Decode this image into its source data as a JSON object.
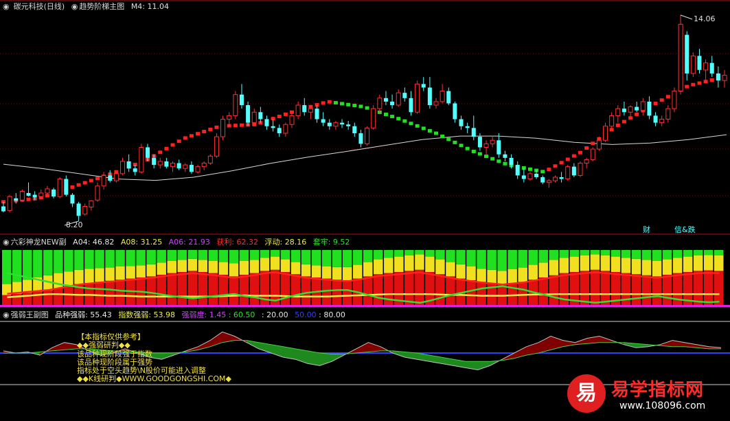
{
  "panel1": {
    "stock": "碳元科技(日线)",
    "indicator": "趋势阶梯主图",
    "m4": "M4: 11.04",
    "high_label": "14.06",
    "low_label": "8.20",
    "tag_cai": "财",
    "tag_xinfa": "信&跌"
  },
  "panel2": {
    "name": "六彩神龙NEW副",
    "a04": "A04: 46.82",
    "a08": "A08: 31.25",
    "a06": "A06: 21.93",
    "huoli": "获利: 62.32",
    "fudong": "浮动: 28.16",
    "taolao": "套牢: 9.52"
  },
  "panel3": {
    "name": "强弱王副图",
    "pinzhong": "品种强弱: 55.43",
    "zhishu": "指数强弱: 53.98",
    "qiangruodu": "强弱度: 1.45",
    "v1": ": 60.50",
    "v2": ": 20.00",
    "v3": "50.00",
    "v4": ": 80.00",
    "notes": [
      "【本指标仅供参考】",
      "◆◆强弱研判◆◆",
      "该品种现阶段强于指数",
      "该品种现阶段属于强势",
      "指标处于空头趋势\\N股价可能进入调整",
      "◆◆K线研判◆WWW.GOODGONGSHI.COM◆"
    ]
  },
  "watermark": {
    "logo": "易",
    "title": "易学指标网",
    "url": "www.108096.com"
  },
  "colors": {
    "up": "#ff3030",
    "down": "#54ffff",
    "step_up": "#ff2020",
    "step_down": "#20e020",
    "ma": "#d8d8d8"
  },
  "chart_data": [
    {
      "type": "candlestick",
      "title": "趋势阶梯主图",
      "high": 14.06,
      "low": 8.2,
      "ylim": [
        8.0,
        14.6
      ],
      "ohlc": [
        [
          8.62,
          8.75,
          8.45,
          8.48
        ],
        [
          8.5,
          8.95,
          8.45,
          8.9
        ],
        [
          8.85,
          9.0,
          8.7,
          8.78
        ],
        [
          8.8,
          9.1,
          8.75,
          9.05
        ],
        [
          9.0,
          9.3,
          8.9,
          8.92
        ],
        [
          8.95,
          9.05,
          8.8,
          8.88
        ],
        [
          8.9,
          9.1,
          8.85,
          9.0
        ],
        [
          9.0,
          9.2,
          8.95,
          9.12
        ],
        [
          9.1,
          9.15,
          8.85,
          8.9
        ],
        [
          8.9,
          9.45,
          8.85,
          9.4
        ],
        [
          9.4,
          9.5,
          8.9,
          8.95
        ],
        [
          8.95,
          9.0,
          8.6,
          8.7
        ],
        [
          8.7,
          8.75,
          8.2,
          8.35
        ],
        [
          8.4,
          8.7,
          8.35,
          8.62
        ],
        [
          8.6,
          8.8,
          8.5,
          8.78
        ],
        [
          8.8,
          9.3,
          8.75,
          9.2
        ],
        [
          9.2,
          9.6,
          9.1,
          9.5
        ],
        [
          9.5,
          9.65,
          9.3,
          9.35
        ],
        [
          9.35,
          9.6,
          9.3,
          9.55
        ],
        [
          9.55,
          10.0,
          9.5,
          9.9
        ],
        [
          9.9,
          10.1,
          9.6,
          9.7
        ],
        [
          9.7,
          9.8,
          9.5,
          9.6
        ],
        [
          9.6,
          10.4,
          9.55,
          10.3
        ],
        [
          10.3,
          10.4,
          9.9,
          10.0
        ],
        [
          10.0,
          10.1,
          9.7,
          9.8
        ],
        [
          9.8,
          10.0,
          9.7,
          9.9
        ],
        [
          9.9,
          10.0,
          9.7,
          9.75
        ],
        [
          9.75,
          9.9,
          9.6,
          9.85
        ],
        [
          9.85,
          9.95,
          9.65,
          9.7
        ],
        [
          9.7,
          9.85,
          9.6,
          9.8
        ],
        [
          9.8,
          9.9,
          9.55,
          9.6
        ],
        [
          9.6,
          9.8,
          9.55,
          9.75
        ],
        [
          9.75,
          9.9,
          9.65,
          9.85
        ],
        [
          9.85,
          10.1,
          9.8,
          10.05
        ],
        [
          10.05,
          10.7,
          10.0,
          10.6
        ],
        [
          10.6,
          11.2,
          10.5,
          11.1
        ],
        [
          11.1,
          11.3,
          10.9,
          11.2
        ],
        [
          11.2,
          11.9,
          11.1,
          11.8
        ],
        [
          11.8,
          12.1,
          11.4,
          11.5
        ],
        [
          11.5,
          11.6,
          10.9,
          11.0
        ],
        [
          11.0,
          11.4,
          10.9,
          11.3
        ],
        [
          11.3,
          11.45,
          11.0,
          11.1
        ],
        [
          11.1,
          11.2,
          10.8,
          10.9
        ],
        [
          10.9,
          11.1,
          10.75,
          10.85
        ],
        [
          10.85,
          10.95,
          10.6,
          10.7
        ],
        [
          10.7,
          11.0,
          10.6,
          10.95
        ],
        [
          10.95,
          11.3,
          10.85,
          11.2
        ],
        [
          11.2,
          11.6,
          11.1,
          11.5
        ],
        [
          11.5,
          11.7,
          11.2,
          11.3
        ],
        [
          11.3,
          11.5,
          11.1,
          11.4
        ],
        [
          11.4,
          11.5,
          11.0,
          11.1
        ],
        [
          11.1,
          11.3,
          10.9,
          11.0
        ],
        [
          11.0,
          11.1,
          10.8,
          10.9
        ],
        [
          10.9,
          11.05,
          10.8,
          11.0
        ],
        [
          11.0,
          11.1,
          10.85,
          10.95
        ],
        [
          10.95,
          11.05,
          10.8,
          10.9
        ],
        [
          10.9,
          11.0,
          10.6,
          10.7
        ],
        [
          10.7,
          10.8,
          10.3,
          10.4
        ],
        [
          10.4,
          10.9,
          10.35,
          10.85
        ],
        [
          10.85,
          11.5,
          10.8,
          11.4
        ],
        [
          11.4,
          11.8,
          11.3,
          11.7
        ],
        [
          11.7,
          11.9,
          11.5,
          11.6
        ],
        [
          11.6,
          11.8,
          11.4,
          11.5
        ],
        [
          11.5,
          11.95,
          11.45,
          11.85
        ],
        [
          11.85,
          12.0,
          11.6,
          11.7
        ],
        [
          11.7,
          11.9,
          11.2,
          11.3
        ],
        [
          11.3,
          12.2,
          11.25,
          12.1
        ],
        [
          12.1,
          12.3,
          11.9,
          12.0
        ],
        [
          12.0,
          12.3,
          11.4,
          11.5
        ],
        [
          11.5,
          11.7,
          11.4,
          11.6
        ],
        [
          11.6,
          12.1,
          11.55,
          11.9
        ],
        [
          11.9,
          12.0,
          11.5,
          11.55
        ],
        [
          11.55,
          11.6,
          11.0,
          11.1
        ],
        [
          11.1,
          11.2,
          10.8,
          10.9
        ],
        [
          10.9,
          11.0,
          10.7,
          10.85
        ],
        [
          10.85,
          11.2,
          10.5,
          10.6
        ],
        [
          10.6,
          10.7,
          10.2,
          10.3
        ],
        [
          10.3,
          10.5,
          10.1,
          10.4
        ],
        [
          10.4,
          10.6,
          10.3,
          10.5
        ],
        [
          10.5,
          10.7,
          10.0,
          10.1
        ],
        [
          10.1,
          10.2,
          9.9,
          10.0
        ],
        [
          10.0,
          10.1,
          9.7,
          9.8
        ],
        [
          9.8,
          9.9,
          9.4,
          9.5
        ],
        [
          9.5,
          9.7,
          9.3,
          9.4
        ],
        [
          9.4,
          9.6,
          9.35,
          9.55
        ],
        [
          9.55,
          9.65,
          9.4,
          9.45
        ],
        [
          9.45,
          9.5,
          9.25,
          9.3
        ],
        [
          9.3,
          9.4,
          9.15,
          9.35
        ],
        [
          9.35,
          9.5,
          9.3,
          9.45
        ],
        [
          9.45,
          9.6,
          9.3,
          9.4
        ],
        [
          9.4,
          9.8,
          9.35,
          9.75
        ],
        [
          9.75,
          9.85,
          9.45,
          9.5
        ],
        [
          9.5,
          9.9,
          9.45,
          9.85
        ],
        [
          9.85,
          10.0,
          9.7,
          9.95
        ],
        [
          9.95,
          10.3,
          9.9,
          10.25
        ],
        [
          10.25,
          10.6,
          10.2,
          10.5
        ],
        [
          10.5,
          11.0,
          10.45,
          10.9
        ],
        [
          10.9,
          11.3,
          10.85,
          11.2
        ],
        [
          11.2,
          11.5,
          11.0,
          11.4
        ],
        [
          11.4,
          11.6,
          11.2,
          11.3
        ],
        [
          11.3,
          11.5,
          11.1,
          11.45
        ],
        [
          11.45,
          11.6,
          11.3,
          11.35
        ],
        [
          11.35,
          11.7,
          11.2,
          11.6
        ],
        [
          11.6,
          11.75,
          11.1,
          11.2
        ],
        [
          11.2,
          11.3,
          10.9,
          11.0
        ],
        [
          11.0,
          11.2,
          10.9,
          11.1
        ],
        [
          11.1,
          11.5,
          11.0,
          11.4
        ],
        [
          11.4,
          12.0,
          11.3,
          11.9
        ],
        [
          11.9,
          14.06,
          11.8,
          13.8
        ],
        [
          13.5,
          13.6,
          12.2,
          12.4
        ],
        [
          12.4,
          13.0,
          12.3,
          12.9
        ],
        [
          12.9,
          13.1,
          12.4,
          12.5
        ],
        [
          12.5,
          12.8,
          12.2,
          12.7
        ],
        [
          12.7,
          12.9,
          12.3,
          12.4
        ],
        [
          12.4,
          12.6,
          12.0,
          12.2
        ],
        [
          12.2,
          12.5,
          12.0,
          12.35
        ]
      ],
      "ma_values": [
        9.82,
        9.7,
        9.55,
        9.4,
        9.36,
        9.45,
        9.63,
        9.84,
        10.02,
        10.18,
        10.35,
        10.52,
        10.62,
        10.62,
        10.56,
        10.44,
        10.38,
        10.42,
        10.52,
        10.66
      ],
      "step_values": [
        8.75,
        8.85,
        9.2,
        9.55,
        9.95,
        10.55,
        10.9,
        10.95,
        11.3,
        11.6,
        11.45,
        11.1,
        10.7,
        10.2,
        9.8,
        9.6,
        10.15,
        10.9,
        11.5,
        12.05,
        12.3
      ]
    },
    {
      "type": "bar",
      "title": "六彩神龙NEW副",
      "series": [
        {
          "name": "获利",
          "values": [
            18,
            20,
            22,
            24,
            26,
            30,
            34,
            38,
            40,
            42,
            44,
            46,
            48,
            50,
            52,
            55,
            58,
            60,
            62,
            60,
            58,
            55,
            52,
            55,
            58,
            62,
            64,
            60,
            56,
            52,
            50,
            48,
            46,
            45,
            48,
            52,
            56,
            58,
            60,
            62,
            64,
            60,
            56,
            52,
            48,
            45,
            42,
            40,
            38,
            40,
            42,
            46,
            50,
            54,
            58,
            60,
            62,
            64,
            62,
            60,
            58,
            56,
            54,
            52,
            55,
            58,
            60,
            62,
            63,
            62
          ]
        },
        {
          "name": "浮动",
          "values": [
            20,
            22,
            24,
            26,
            28,
            28,
            27,
            26,
            26,
            25,
            24,
            24,
            23,
            22,
            22,
            22,
            22,
            22,
            22,
            22,
            22,
            23,
            24,
            25,
            24,
            24,
            24,
            23,
            22,
            22,
            22,
            22,
            23,
            24,
            25,
            26,
            27,
            28,
            28,
            28,
            28,
            28,
            27,
            26,
            26,
            25,
            24,
            24,
            24,
            25,
            26,
            27,
            27,
            28,
            28,
            28,
            28,
            28,
            28,
            28,
            28,
            28,
            28,
            28,
            28,
            28,
            28,
            28,
            28,
            28
          ]
        },
        {
          "name": "套牢",
          "values": [
            62,
            58,
            54,
            50,
            46,
            42,
            39,
            36,
            34,
            33,
            32,
            30,
            29,
            28,
            26,
            23,
            20,
            18,
            16,
            18,
            20,
            22,
            24,
            20,
            18,
            14,
            12,
            17,
            22,
            26,
            28,
            30,
            31,
            31,
            27,
            22,
            17,
            14,
            12,
            10,
            8,
            12,
            17,
            22,
            26,
            30,
            34,
            36,
            38,
            35,
            32,
            27,
            23,
            18,
            14,
            12,
            10,
            8,
            10,
            12,
            14,
            16,
            18,
            20,
            17,
            14,
            12,
            10,
            9,
            10
          ]
        }
      ]
    },
    {
      "type": "area",
      "title": "强弱王副图",
      "series": [
        {
          "name": "品种强弱",
          "values": [
            52,
            50,
            51,
            48,
            55,
            60,
            58,
            52,
            48,
            50,
            54,
            50,
            46,
            44,
            48,
            52,
            56,
            62,
            70,
            66,
            60,
            54,
            50,
            46,
            44,
            40,
            38,
            42,
            48,
            54,
            60,
            56,
            50,
            46,
            44,
            42,
            40,
            38,
            36,
            34,
            38,
            44,
            50,
            56,
            60,
            66,
            62,
            60,
            64,
            66,
            62,
            58,
            55,
            56,
            58,
            62,
            60,
            58,
            56,
            55
          ]
        },
        {
          "name": "指数强弱",
          "values": [
            50,
            50,
            50,
            51,
            52,
            53,
            54,
            54,
            53,
            52,
            51,
            51,
            50,
            50,
            50,
            51,
            53,
            56,
            60,
            62,
            62,
            60,
            58,
            56,
            54,
            52,
            50,
            49,
            49,
            50,
            51,
            52,
            52,
            51,
            50,
            48,
            46,
            44,
            42,
            42,
            42,
            43,
            45,
            48,
            50,
            53,
            56,
            58,
            59,
            60,
            60,
            60,
            59,
            58,
            57,
            56,
            56,
            55,
            54,
            54
          ]
        }
      ],
      "levels": [
        50,
        80,
        20
      ]
    }
  ]
}
